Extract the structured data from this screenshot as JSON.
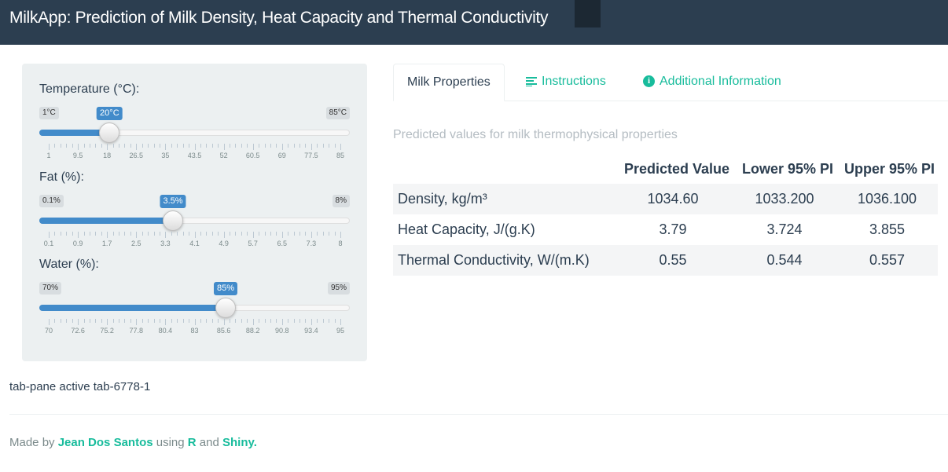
{
  "navbar": {
    "title": "MilkApp: Prediction of Milk Density, Heat Capacity and Thermal Conductivity"
  },
  "sliders": [
    {
      "label": "Temperature (°C):",
      "min_label": "1°C",
      "max_label": "85°C",
      "value_label": "20°C",
      "min": 1,
      "max": 85,
      "value": 20,
      "ticks": [
        "1",
        "9.5",
        "18",
        "26.5",
        "35",
        "43.5",
        "52",
        "60.5",
        "69",
        "77.5",
        "85"
      ]
    },
    {
      "label": "Fat (%):",
      "min_label": "0.1%",
      "max_label": "8%",
      "value_label": "3.5%",
      "min": 0.1,
      "max": 8,
      "value": 3.5,
      "ticks": [
        "0.1",
        "0.9",
        "1.7",
        "2.5",
        "3.3",
        "4.1",
        "4.9",
        "5.7",
        "6.5",
        "7.3",
        "8"
      ]
    },
    {
      "label": "Water (%):",
      "min_label": "70%",
      "max_label": "95%",
      "value_label": "85%",
      "min": 70,
      "max": 95,
      "value": 85,
      "ticks": [
        "70",
        "72.6",
        "75.2",
        "77.8",
        "80.4",
        "83",
        "85.6",
        "88.2",
        "90.8",
        "93.4",
        "95"
      ]
    }
  ],
  "tabs": [
    {
      "label": "Milk Properties",
      "icon": "",
      "active": true
    },
    {
      "label": "Instructions",
      "icon": "list-icon",
      "active": false
    },
    {
      "label": "Additional Information",
      "icon": "info-circle-icon",
      "active": false
    }
  ],
  "results": {
    "subtitle": "Predicted values for milk thermophysical properties",
    "headers": [
      "",
      "Predicted Value",
      "Lower 95% PI",
      "Upper 95% PI"
    ],
    "rows": [
      [
        "Density, kg/m³",
        "1034.60",
        "1033.200",
        "1036.100"
      ],
      [
        "Heat Capacity, J/(g.K)",
        "3.79",
        "3.724",
        "3.855"
      ],
      [
        "Thermal Conductivity, W/(m.K)",
        "0.55",
        "0.544",
        "0.557"
      ]
    ]
  },
  "tabpane_text": "tab-pane active tab-6778-1",
  "footer": {
    "prefix": "Made by ",
    "author": "Jean Dos Santos",
    "middle1": " using ",
    "r": "R",
    "middle2": " and ",
    "shiny": "Shiny."
  },
  "colors": {
    "navbar": "#2c3e50",
    "accent": "#18bc9c",
    "slider": "#428bca"
  }
}
